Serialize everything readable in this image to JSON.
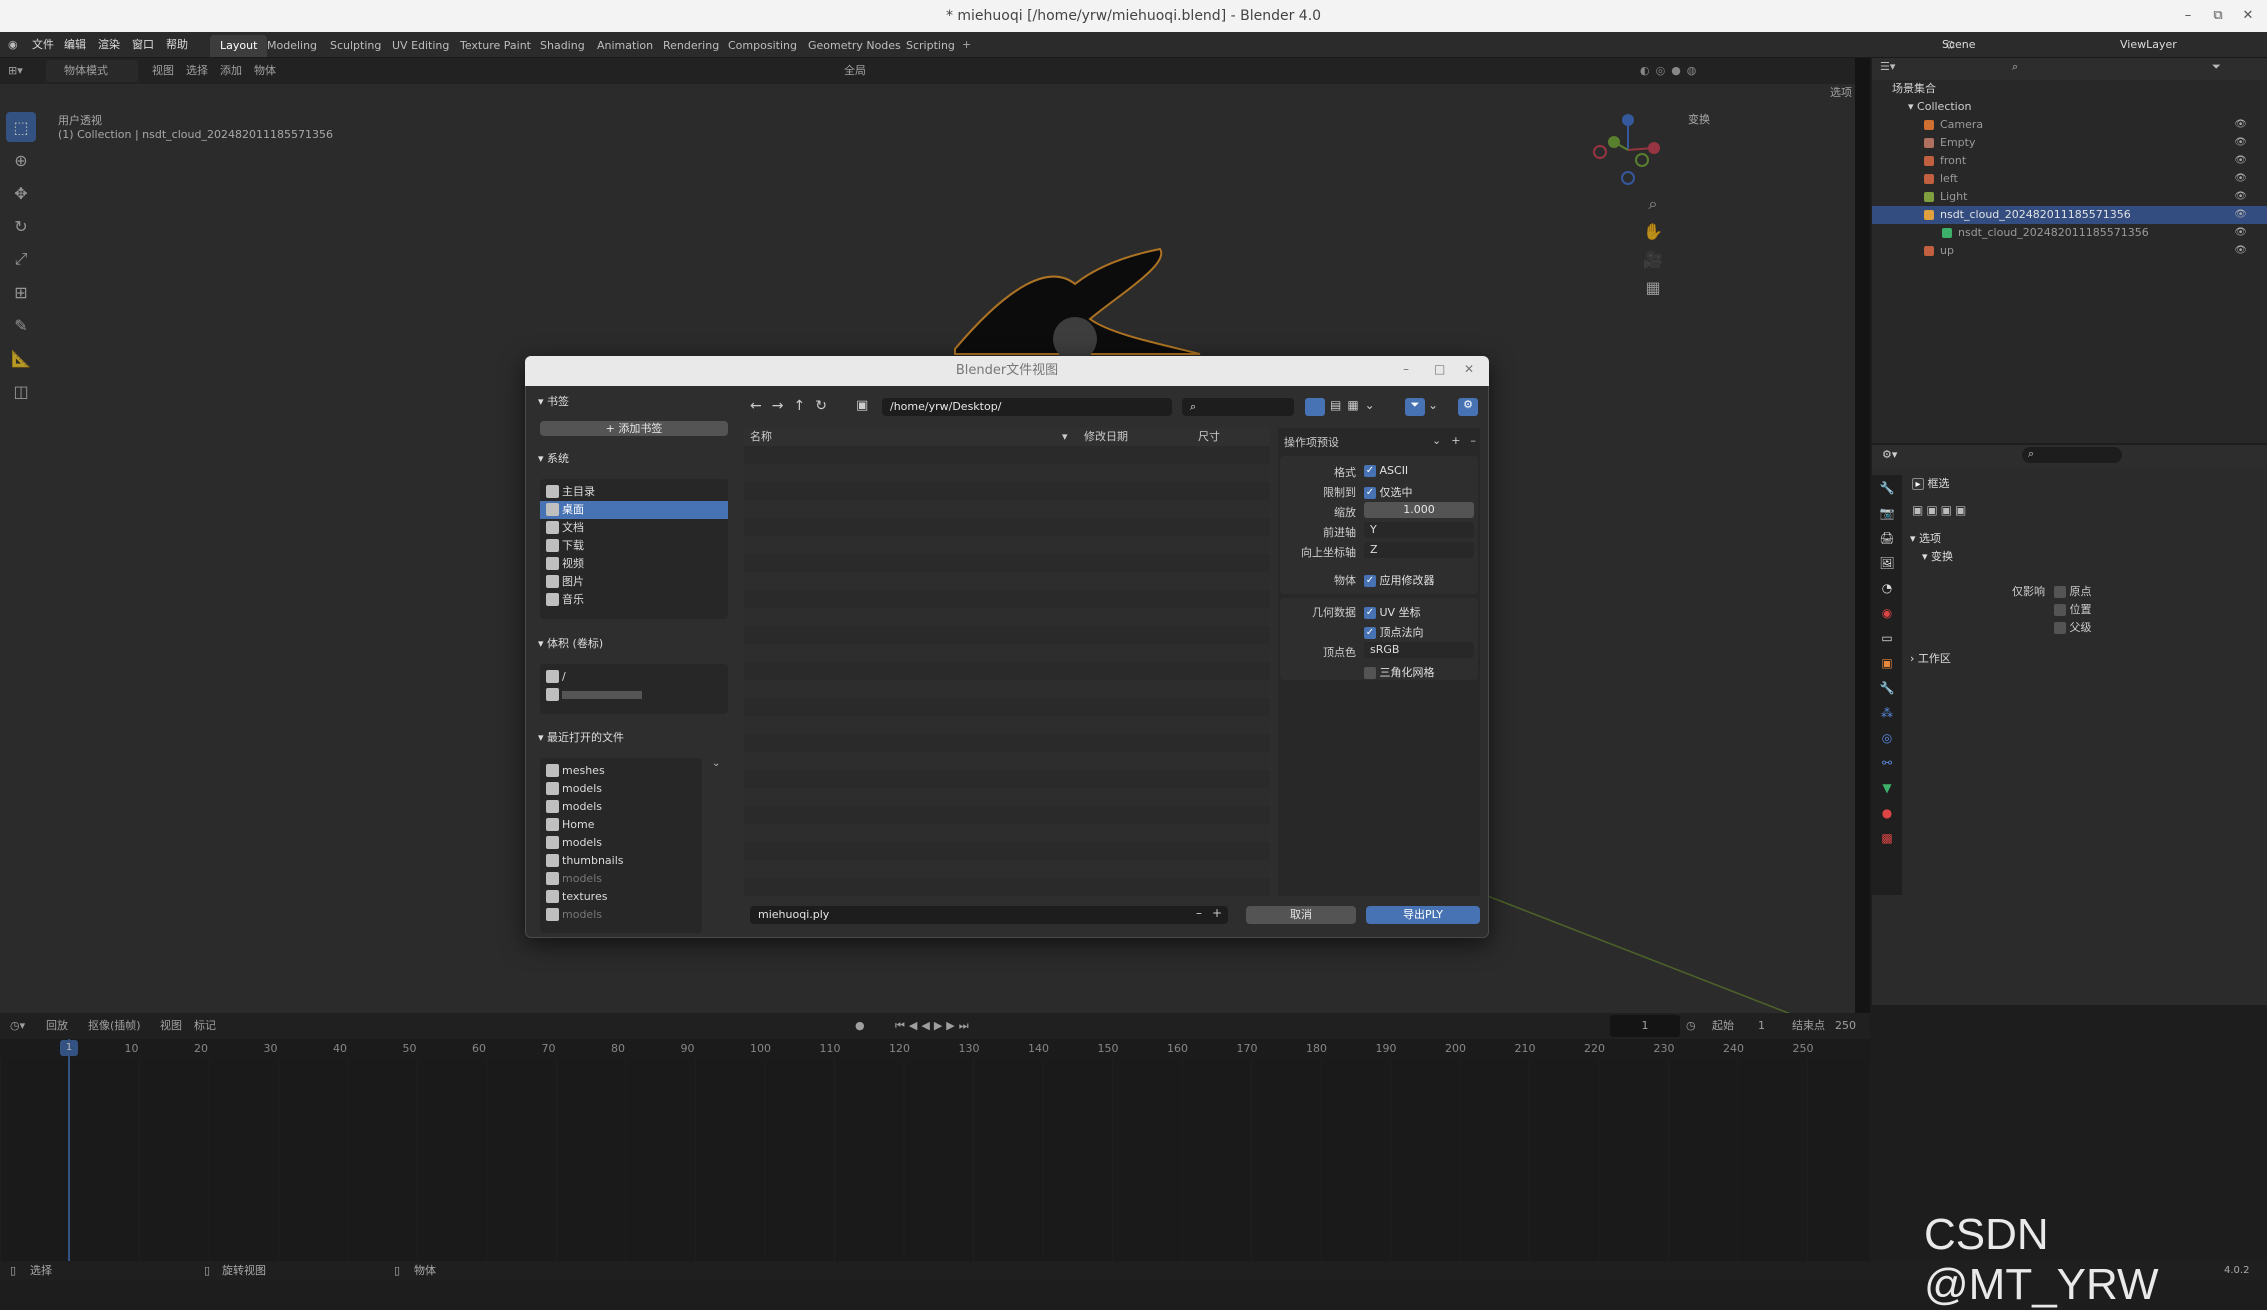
{
  "window": {
    "title": "* miehuoqi [/home/yrw/miehuoqi.blend] - Blender 4.0"
  },
  "menus": [
    "文件",
    "编辑",
    "渲染",
    "窗口",
    "帮助"
  ],
  "workspaces": [
    "Layout",
    "Modeling",
    "Sculpting",
    "UV Editing",
    "Texture Paint",
    "Shading",
    "Animation",
    "Rendering",
    "Compositing",
    "Geometry Nodes",
    "Scripting"
  ],
  "active_workspace": "Layout",
  "scene": {
    "name": "Scene",
    "view_layer": "ViewLayer"
  },
  "viewport": {
    "mode": "物体模式",
    "menus": [
      "视图",
      "选择",
      "添加",
      "物体"
    ],
    "transform_orientation": "全局",
    "options_label": "选项",
    "overlay_title": "用户透视",
    "overlay_subtitle": "(1) Collection | nsdt_cloud_202482011185571356",
    "sidebar_transform": "变换"
  },
  "outliner": {
    "root": "场景集合",
    "collection": "Collection",
    "items": [
      {
        "name": "Camera",
        "selected": false
      },
      {
        "name": "Empty",
        "selected": false
      },
      {
        "name": "front",
        "selected": false
      },
      {
        "name": "left",
        "selected": false
      },
      {
        "name": "Light",
        "selected": false
      },
      {
        "name": "nsdt_cloud_202482011185571356",
        "selected": true
      },
      {
        "name": "nsdt_cloud_202482011185571356",
        "selected": false,
        "child": true
      },
      {
        "name": "up",
        "selected": false
      }
    ]
  },
  "properties": {
    "tool_name": "框选",
    "section_options": "选项",
    "section_transform": "变换",
    "affect_only": "仅影响",
    "affect_items": [
      "原点",
      "位置",
      "父级"
    ],
    "section_workspace": "工作区"
  },
  "timeline": {
    "menus": [
      "回放",
      "抠像(插帧)",
      "视图",
      "标记"
    ],
    "current_frame": "1",
    "start_label": "起始",
    "start": "1",
    "end_label": "结束点",
    "end": "250",
    "ticks": [
      "1",
      "10",
      "20",
      "30",
      "40",
      "50",
      "60",
      "70",
      "80",
      "90",
      "100",
      "110",
      "120",
      "130",
      "140",
      "150",
      "160",
      "170",
      "180",
      "190",
      "200",
      "210",
      "220",
      "230",
      "240",
      "250"
    ]
  },
  "statusbar": {
    "items": [
      "选择",
      "旋转视图",
      "物体"
    ],
    "version": "4.0.2"
  },
  "dialog": {
    "title": "Blender文件视图",
    "bookmarks_label": "书签",
    "add_bookmark": "添加书签",
    "system_label": "系统",
    "system_items": [
      {
        "label": "主目录",
        "selected": false
      },
      {
        "label": "桌面",
        "selected": true
      },
      {
        "label": "文档",
        "selected": false
      },
      {
        "label": "下载",
        "selected": false
      },
      {
        "label": "视频",
        "selected": false
      },
      {
        "label": "图片",
        "selected": false
      },
      {
        "label": "音乐",
        "selected": false
      }
    ],
    "volumes_label": "体积 (卷标)",
    "volumes": [
      "/"
    ],
    "recent_label": "最近打开的文件",
    "recent_items": [
      "meshes",
      "models",
      "models",
      "Home",
      "models",
      "thumbnails",
      "models",
      "textures",
      "models"
    ],
    "path": "/home/yrw/Desktop/",
    "columns": {
      "name": "名称",
      "modified": "修改日期",
      "size": "尺寸"
    },
    "operator_presets": "操作项预设",
    "options": {
      "format_label": "格式",
      "format_value": "ASCII",
      "limit_label": "限制到",
      "limit_value": "仅选中",
      "scale_label": "缩放",
      "scale_value": "1.000",
      "forward_label": "前进轴",
      "forward_value": "Y",
      "up_label": "向上坐标轴",
      "up_value": "Z",
      "object_label": "物体",
      "object_value": "应用修改器",
      "geometry_label": "几何数据",
      "uv_value": "UV 坐标",
      "normals_value": "顶点法向",
      "vcolor_label": "顶点色",
      "vcolor_value": "sRGB",
      "triangulate_value": "三角化网格"
    },
    "filename": "miehuoqi.ply",
    "cancel": "取消",
    "export": "导出PLY"
  },
  "watermark": "CSDN @MT_YRW",
  "colors": {
    "accent": "#4772b3",
    "selection_outline": "#f0a030"
  }
}
